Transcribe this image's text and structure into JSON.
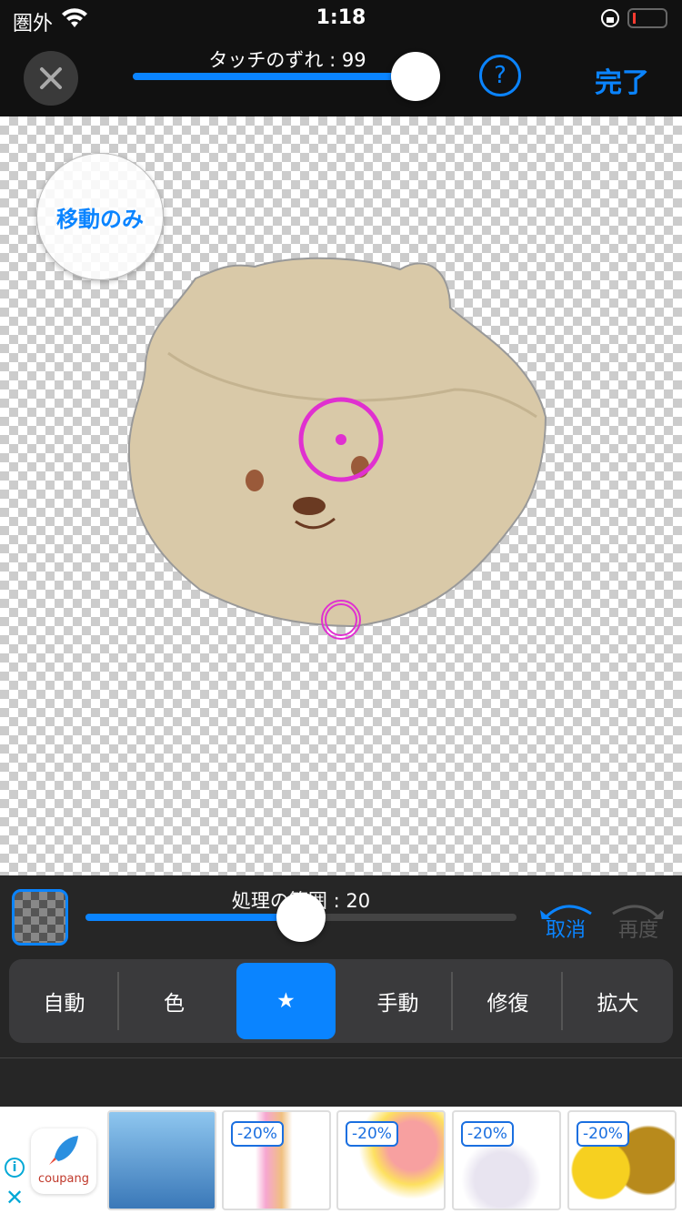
{
  "status": {
    "carrier": "圏外",
    "time": "1:18"
  },
  "topbar": {
    "touch_offset_label": "タッチのずれ : 99",
    "touch_offset_value": 99,
    "touch_offset_max": 100,
    "help": "?",
    "done": "完了"
  },
  "canvas": {
    "move_only": "移動のみ"
  },
  "bottom": {
    "range_label": "処理の範囲 : 20",
    "range_value": 0.5,
    "undo": "取消",
    "redo": "再度",
    "tabs": [
      {
        "label": "自動"
      },
      {
        "label": "色"
      },
      {
        "label": "★"
      },
      {
        "label": "手動"
      },
      {
        "label": "修復"
      },
      {
        "label": "拡大"
      }
    ]
  },
  "ad": {
    "brand": "coupang",
    "info": "i",
    "close": "✕",
    "products": [
      {
        "badge": ""
      },
      {
        "badge": "-20%"
      },
      {
        "badge": "-20%"
      },
      {
        "badge": "-20%"
      },
      {
        "badge": "-20%"
      }
    ]
  },
  "colors": {
    "accent": "#0a84ff",
    "highlight": "#e030d0"
  }
}
